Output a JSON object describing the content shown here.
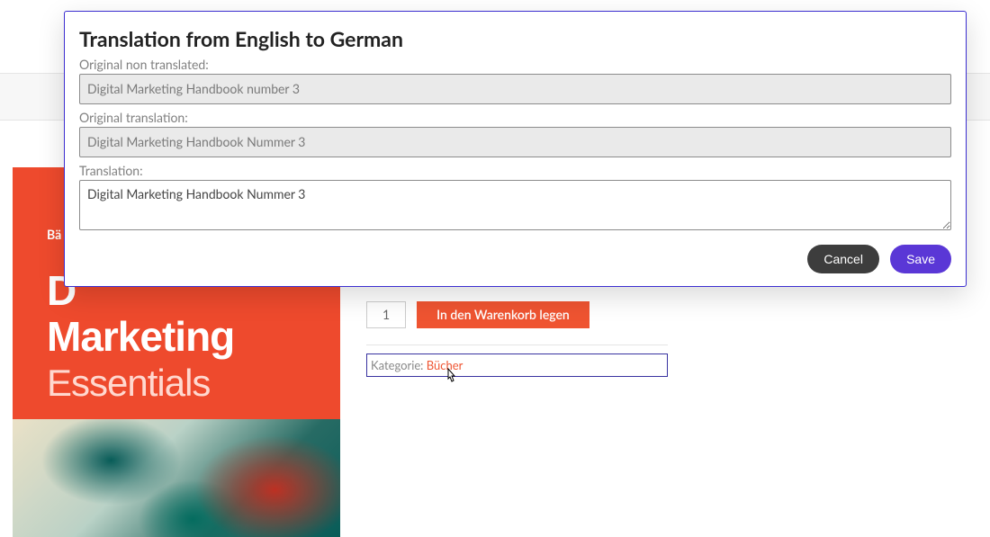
{
  "modal": {
    "title": "Translation from English to German",
    "original_non_translated_label": "Original non translated:",
    "original_non_translated_value": "Digital Marketing Handbook number 3",
    "original_translation_label": "Original translation:",
    "original_translation_value": "Digital Marketing Handbook Nummer 3",
    "translation_label": "Translation:",
    "translation_value": "Digital Marketing Handbook Nummer 3",
    "cancel": "Cancel",
    "save": "Save"
  },
  "product": {
    "cover_top": "Bä",
    "cover_line1": "D\nMarketing",
    "cover_line2": "Essentials",
    "cover_main_1": "D",
    "cover_main_2": "Marketing",
    "cover_sub": "Essentials",
    "quantity": "1",
    "add_to_cart": "In den Warenkorb legen",
    "category_label": "Kategorie: ",
    "category_value": "Bücher"
  },
  "colors": {
    "accent": "#ef5431",
    "primary": "#5a37d6",
    "modal_border": "#3b2ed0"
  }
}
